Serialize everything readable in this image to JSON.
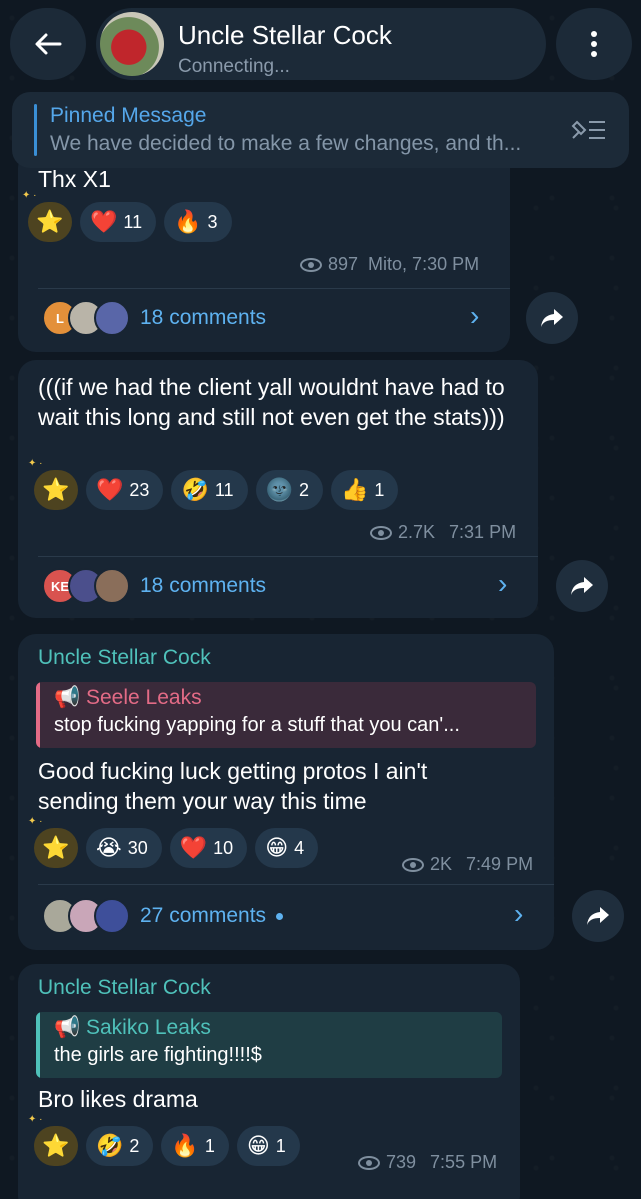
{
  "header": {
    "title": "Uncle Stellar Cock",
    "status": "Connecting..."
  },
  "pinned": {
    "title": "Pinned Message",
    "text": "We have decided to make a few changes, and th..."
  },
  "messages": [
    {
      "text": "Thx X1",
      "reactions": [
        {
          "emoji": "❤️",
          "count": "11"
        },
        {
          "emoji": "🔥",
          "count": "3"
        }
      ],
      "views": "897",
      "author_time": "Mito, 7:30 PM",
      "avatars": [
        "L",
        "",
        ""
      ],
      "comments": "18 comments"
    },
    {
      "text": "(((if we had the client yall wouldnt have had to wait this long and still not even get the stats)))",
      "reactions": [
        {
          "emoji": "❤️",
          "count": "23"
        },
        {
          "emoji": "🤣",
          "count": "11"
        },
        {
          "emoji": "🌚",
          "count": "2"
        },
        {
          "emoji": "👍",
          "count": "1"
        }
      ],
      "views": "2.7K",
      "time": "7:31 PM",
      "avatars": [
        "KE",
        "",
        ""
      ],
      "comments": "18 comments"
    },
    {
      "sender": "Uncle Stellar Cock",
      "quote_title": "Seele Leaks",
      "quote_text": "stop fucking yapping for a stuff that you can'...",
      "text_line1": "Good fucking luck getting protos I ain't",
      "text_line2": "sending them your way this time",
      "reactions": [
        {
          "emoji": "😭",
          "count": "30"
        },
        {
          "emoji": "❤️",
          "count": "10"
        },
        {
          "emoji": "😁",
          "count": "4"
        }
      ],
      "views": "2K",
      "time": "7:49 PM",
      "comments": "27 comments"
    },
    {
      "sender": "Uncle Stellar Cock",
      "quote_title": "Sakiko Leaks",
      "quote_text": "the girls are fighting!!!!$",
      "text": "Bro likes drama",
      "reactions": [
        {
          "emoji": "🤣",
          "count": "2"
        },
        {
          "emoji": "🔥",
          "count": "1"
        },
        {
          "emoji": "😁",
          "count": "1"
        }
      ],
      "views": "739",
      "time": "7:55 PM"
    }
  ],
  "star_emoji": "⭐",
  "colors": {
    "background": "#0f1822",
    "bubble": "#182533",
    "accent": "#5eb2f0",
    "sender": "#4fc1ba",
    "quote_red": "#e36b86",
    "quote_teal": "#4fc1ba"
  }
}
